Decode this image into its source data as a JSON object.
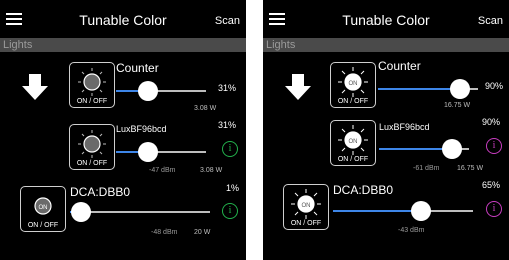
{
  "screens": [
    {
      "app_title": "Tunable Color",
      "scan_label": "Scan",
      "section_label": "Lights",
      "lights": [
        {
          "name": "Counter",
          "bulb_label": "ON / OFF",
          "state": "off",
          "percent": "31%",
          "level": 0.31,
          "watts": "3.08 W",
          "rssi": ""
        },
        {
          "name": "LuxBF96bcd",
          "bulb_label": "ON / OFF",
          "state": "off",
          "percent": "31%",
          "level": 0.31,
          "watts": "3.08 W",
          "rssi": "-47 dBm",
          "info_color": "#22b14c"
        },
        {
          "name": "DCA:DBB0",
          "bulb_label": "ON / OFF",
          "state": "group",
          "percent": "1%",
          "level": 0.01,
          "watts": "20 W",
          "rssi": "-48 dBm",
          "info_color": "#22b14c"
        }
      ]
    },
    {
      "app_title": "Tunable Color",
      "scan_label": "Scan",
      "section_label": "Lights",
      "lights": [
        {
          "name": "Counter",
          "bulb_label": "ON / OFF",
          "state": "on",
          "percent": "90%",
          "level": 0.9,
          "watts": "16.75 W",
          "rssi": ""
        },
        {
          "name": "LuxBF96bcd",
          "bulb_label": "ON / OFF",
          "state": "on",
          "percent": "90%",
          "level": 0.9,
          "watts": "16.75 W",
          "rssi": "-61 dBm",
          "info_color": "#c83dc0"
        },
        {
          "name": "DCA:DBB0",
          "bulb_label": "ON / OFF",
          "state": "on",
          "percent": "65%",
          "level": 0.65,
          "watts": "",
          "rssi": "-43 dBm",
          "info_color": "#c83dc0"
        }
      ]
    }
  ],
  "icons": {
    "menu": "hamburger-icon",
    "group": "down-arrow-icon",
    "bulb": "bulb-icon",
    "info": "info-icon"
  },
  "info_glyph": "i",
  "bulb_on_text": "ON"
}
